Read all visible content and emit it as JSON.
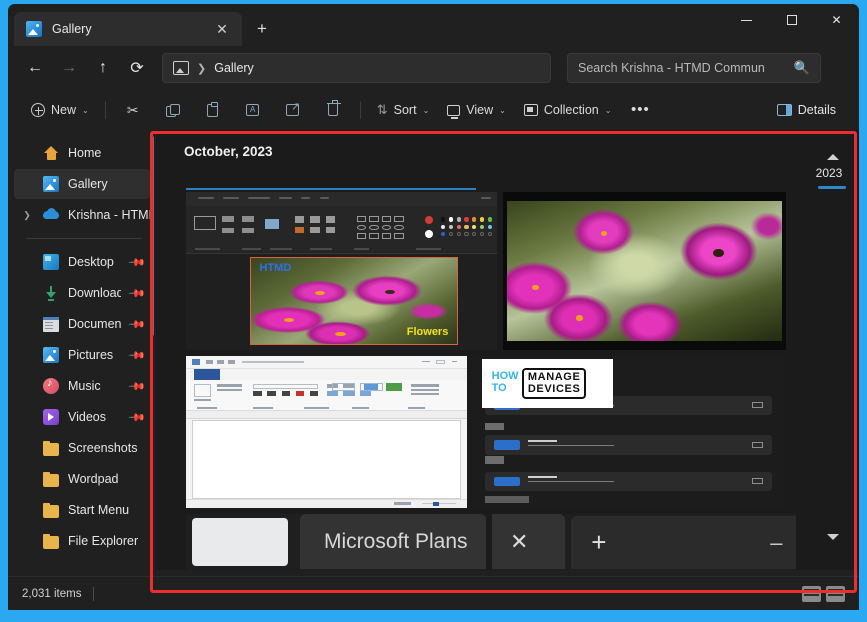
{
  "window": {
    "tab_title": "Gallery",
    "tab_icon": "gallery-image-icon",
    "close_label": "✕",
    "newtab_label": "+",
    "minimize_label": "",
    "maximize_label": "",
    "close_window_label": "✕"
  },
  "nav": {
    "back_label": "←",
    "forward_label": "→",
    "up_label": "↑",
    "refresh_label": "⟳",
    "breadcrumb_icon": "gallery-icon",
    "breadcrumb_separator": "❯",
    "breadcrumb_text": "Gallery"
  },
  "search": {
    "placeholder": "Search Krishna - HTMD Commun",
    "icon": "search-icon"
  },
  "toolbar": {
    "new_label": "New",
    "new_chevron": "⌄",
    "cut_icon": "scissors-icon",
    "copy_icon": "copy-icon",
    "paste_icon": "paste-icon",
    "rename_icon": "rename-icon",
    "rename_glyph": "A",
    "share_icon": "share-icon",
    "delete_icon": "trash-icon",
    "sort_label": "Sort",
    "sort_icon": "sort-arrows-icon",
    "sort_chevron": "⌄",
    "view_label": "View",
    "view_icon": "monitor-icon",
    "view_chevron": "⌄",
    "collection_label": "Collection",
    "collection_icon": "collection-icon",
    "collection_chevron": "⌄",
    "more_label": "•••",
    "details_label": "Details",
    "details_icon": "details-pane-icon"
  },
  "sidebar": {
    "items": [
      {
        "label": "Home",
        "icon": "home-icon",
        "selected": false,
        "expander": "",
        "pinned": false
      },
      {
        "label": "Gallery",
        "icon": "gallery-image-icon",
        "selected": true,
        "expander": "",
        "pinned": false
      },
      {
        "label": "Krishna - HTMD",
        "icon": "onedrive-cloud-icon",
        "selected": false,
        "expander": "❯",
        "pinned": false
      },
      {
        "label": "Desktop",
        "icon": "desktop-icon",
        "selected": false,
        "expander": "",
        "pinned": true
      },
      {
        "label": "Downloads",
        "icon": "downloads-arrow-icon",
        "selected": false,
        "expander": "",
        "pinned": true
      },
      {
        "label": "Documents",
        "icon": "document-icon",
        "selected": false,
        "expander": "",
        "pinned": true
      },
      {
        "label": "Pictures",
        "icon": "pictures-icon",
        "selected": false,
        "expander": "",
        "pinned": true
      },
      {
        "label": "Music",
        "icon": "music-note-icon",
        "selected": false,
        "expander": "",
        "pinned": true
      },
      {
        "label": "Videos",
        "icon": "video-icon",
        "selected": false,
        "expander": "",
        "pinned": true
      },
      {
        "label": "Screenshots",
        "icon": "folder-icon",
        "selected": false,
        "expander": "",
        "pinned": false
      },
      {
        "label": "Wordpad",
        "icon": "folder-icon",
        "selected": false,
        "expander": "",
        "pinned": false
      },
      {
        "label": "Start Menu",
        "icon": "folder-icon",
        "selected": false,
        "expander": "",
        "pinned": false
      },
      {
        "label": "File Explorer",
        "icon": "folder-icon",
        "selected": false,
        "expander": "",
        "pinned": false
      }
    ],
    "pin_glyph": "📌"
  },
  "gallery": {
    "month_heading": "October, 2023",
    "year_scroll": {
      "up_arrow": "▲",
      "label": "2023",
      "down_arrow": "▼"
    },
    "items": [
      {
        "name": "paint-flowers-screenshot",
        "kind": "paint-app-screenshot",
        "overlay_top": "HTMD",
        "overlay_bottom": "Flowers"
      },
      {
        "name": "pink-flowers-photo",
        "kind": "photo"
      },
      {
        "name": "wordpad-document-screenshot",
        "kind": "word-document-screenshot"
      },
      {
        "name": "htmd-settings-screenshot",
        "kind": "settings-screenshot",
        "logo_how": "HOW",
        "logo_to": "TO",
        "logo_manage": "MANAGE",
        "logo_devices": "DEVICES"
      },
      {
        "name": "browser-tab-screenshot",
        "kind": "browser-screenshot",
        "tab_title": "Microsoft Plans",
        "close_glyph": "✕",
        "newtab_glyph": "+",
        "minimize_glyph": "–"
      }
    ]
  },
  "status": {
    "item_count": "2,031 items",
    "view_details_icon": "details-view-icon",
    "view_tiles_icon": "tiles-view-icon"
  },
  "annotation": {
    "highlight_color": "#ef2d2d"
  }
}
